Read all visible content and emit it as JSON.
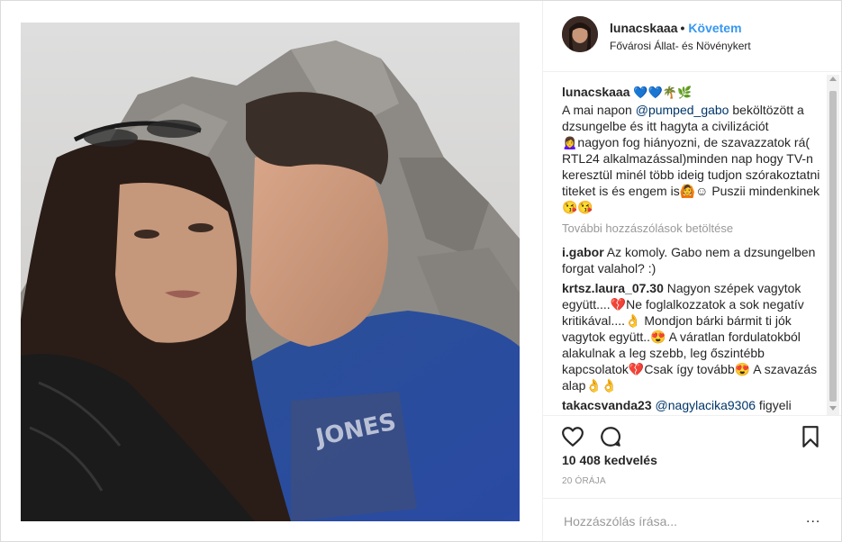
{
  "post": {
    "username": "lunacskaaa",
    "separator": "•",
    "follow_label": "Követem",
    "location": "Fővárosi Állat- és Növénykert"
  },
  "caption": {
    "username": "lunacskaaa",
    "emoji_prefix": "💙💙🌴🌿",
    "text_1": "A mai napon ",
    "mention": "@pumped_gabo",
    "text_2": " beköltözött a dzsungelbe és itt hagyta a civilizációt 🙍‍♀️nagyon fog hiányozni, de szavazzatok rá( RTL24 alkalmazással)minden nap hogy TV-n keresztül minél több ideig tudjon szórakoztatni titeket is és engem is🙆☺ Puszii mindenkinek 😘😘"
  },
  "load_more_label": "További hozzászólások betöltése",
  "comments": [
    {
      "user": "i.gabor",
      "text": "Az komoly. Gabo nem a dzsungelben forgat valahol? :)"
    },
    {
      "user": "krtsz.laura_07.30",
      "text": "Nagyon szépek vagytok együtt....💔Ne foglalkozzatok a sok negatív kritikával....👌 Mondjon bárki bármit ti jók vagytok együtt..😍 A váratlan fordulatokból alakulnak a leg szebb, leg őszintébb kapcsolatok💔Csak így tovább😍 A szavazás alap👌👌"
    },
    {
      "user": "takacsvanda23",
      "mention": "@nagylacika9306",
      "text": " figyeli"
    }
  ],
  "icons": {
    "like": "heart-icon",
    "comment": "comment-bubble-icon",
    "save": "bookmark-icon",
    "options": "more-dots-icon"
  },
  "likes_label": "10 408 kedvelés",
  "time_label": "20 ÓRÁJA",
  "add_comment": {
    "placeholder": "Hozzászólás írása...",
    "options": "..."
  },
  "colors": {
    "accent": "#3897f0",
    "mention": "#003569",
    "border": "#dbdbdb",
    "muted": "#999999"
  }
}
